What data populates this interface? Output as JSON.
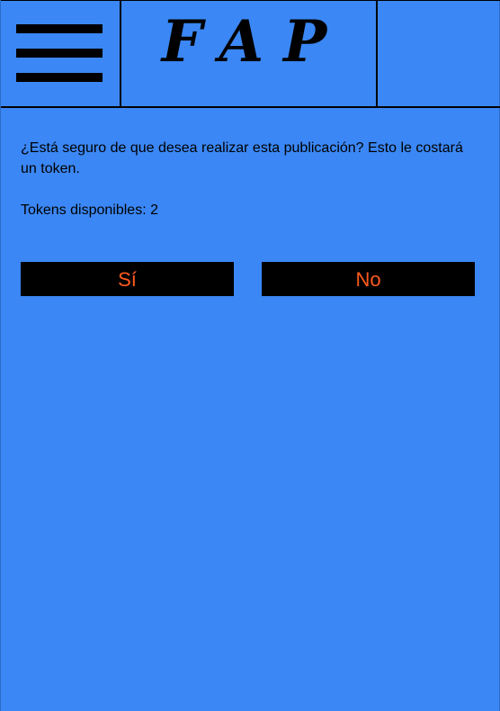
{
  "header": {
    "menu_icon": "hamburger-menu-icon",
    "logo_text": "FAP"
  },
  "dialog": {
    "question": "¿Está seguro de que desea realizar esta publicación? Esto le costará un token.",
    "tokens_label": "Tokens disponibles: 2"
  },
  "buttons": {
    "yes_label": "Sí",
    "no_label": "No"
  },
  "colors": {
    "background": "#3b87f5",
    "button_background": "#000000",
    "button_text": "#ff5a1f"
  }
}
